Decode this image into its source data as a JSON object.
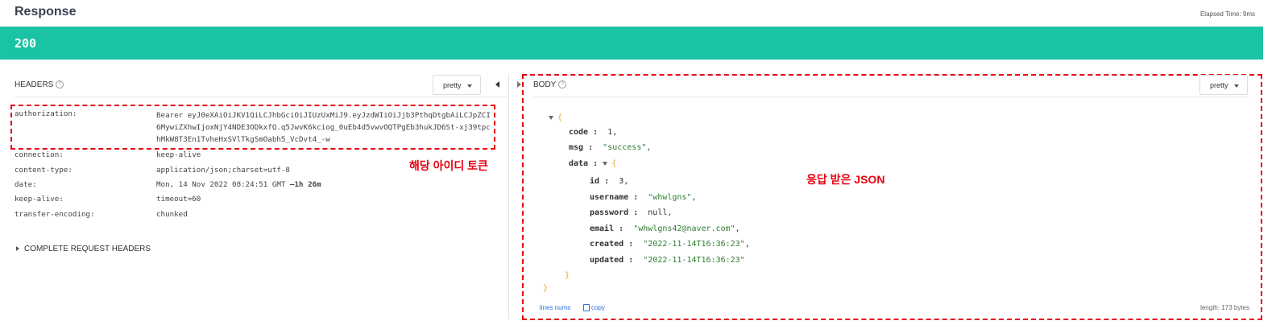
{
  "response": {
    "title": "Response",
    "elapsed": "Elapsed Time: 9ms",
    "status_code": "200"
  },
  "headers_panel": {
    "label": "HEADERS",
    "help_glyph": "?",
    "format_button": "pretty",
    "rows": [
      {
        "key": "authorization:",
        "value": "Bearer eyJ0eXAiOiJKV1QiLCJhbGciOiJIUzUxMiJ9.eyJzdWIiOiJjb3PthqDtgbAiLCJpZCI6MywiZXhwIjoxNjY4NDE3ODkxfQ.q5JwvK6kciog_0uEb4d5vwvOQTPgEb3hukJD6St-xj39tpchMkW8T3En1TvheHxSVlTkgSmOabh5_VcDvt4_-w"
      },
      {
        "key": "connection:",
        "value": "keep-alive"
      },
      {
        "key": "content-type:",
        "value": "application/json;charset=utf-8"
      },
      {
        "key": "date:",
        "value": "Mon, 14 Nov 2022 08:24:51 GMT",
        "extra": "—1h 26m"
      },
      {
        "key": "keep-alive:",
        "value": "timeout=60"
      },
      {
        "key": "transfer-encoding:",
        "value": "chunked"
      }
    ],
    "complete_request_headers": "COMPLETE REQUEST HEADERS",
    "annotation": "해당 아이디 토큰"
  },
  "body_panel": {
    "label": "BODY",
    "help_glyph": "?",
    "format_button": "pretty",
    "json": {
      "open_brace": "{",
      "close_brace": "}",
      "code_key": "code",
      "code_value": "1",
      "msg_key": "msg",
      "msg_value": "\"success\"",
      "data_key": "data",
      "data_open": "{",
      "data_close": "}",
      "id_key": "id",
      "id_value": "3",
      "username_key": "username",
      "username_value": "\"whwlgns\"",
      "password_key": "password",
      "password_value": "null",
      "email_key": "email",
      "email_value": "\"whwlgns42@naver.com\"",
      "created_key": "created",
      "created_value": "\"2022-11-14T16:36:23\"",
      "updated_key": "updated",
      "updated_value": "\"2022-11-14T16:36:23\""
    },
    "annotation": "응답 받은 JSON",
    "line_nums_link": "lines nums",
    "copy_link": "copy",
    "length": "length: 173 bytes"
  },
  "colors": {
    "status_bar": "#1bc3a5",
    "annotation_red": "#e60012",
    "string_green": "#2e7d32",
    "brace_orange": "#f0a020"
  }
}
